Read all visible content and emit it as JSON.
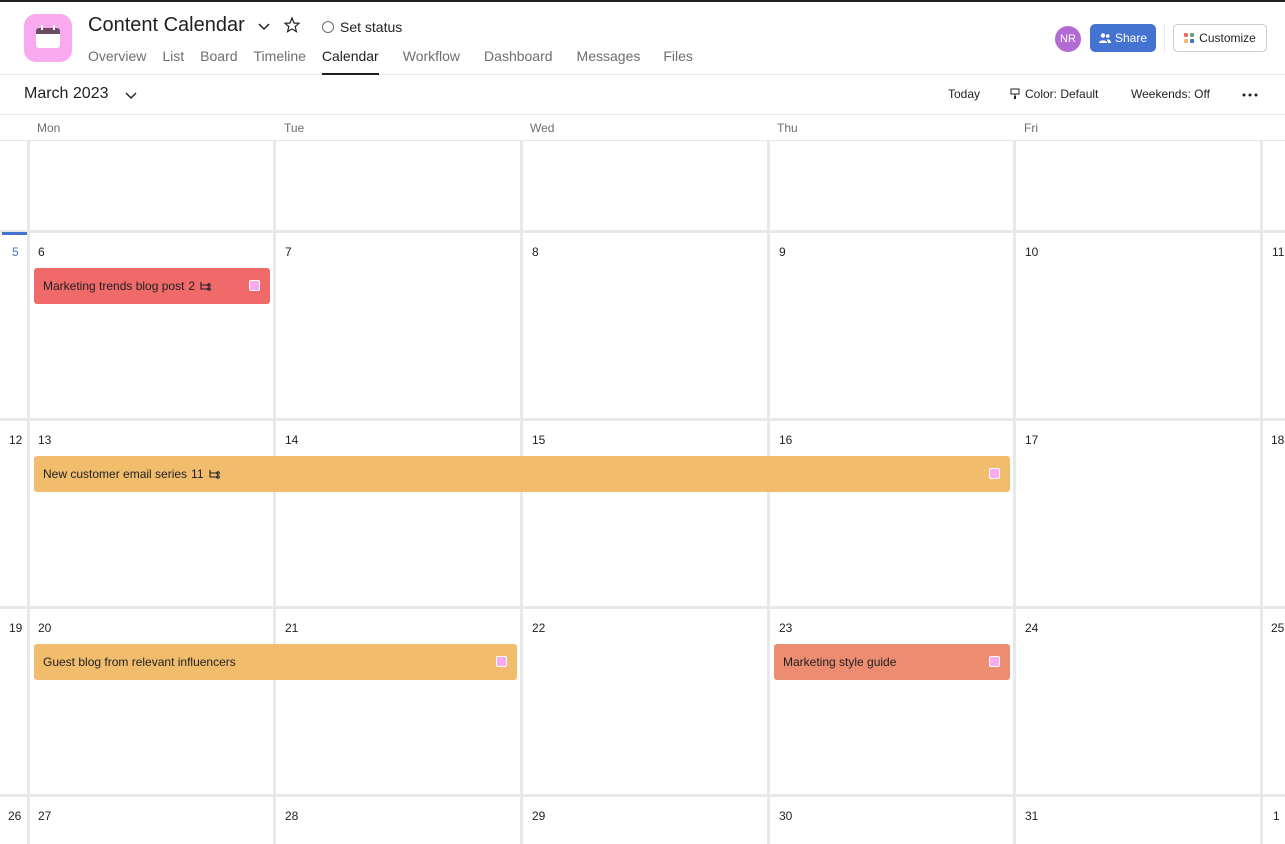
{
  "app": {
    "title": "Content Calendar",
    "set_status_label": "Set status",
    "tabs": [
      {
        "label": "Overview"
      },
      {
        "label": "List"
      },
      {
        "label": "Board"
      },
      {
        "label": "Timeline"
      },
      {
        "label": "Calendar",
        "active": true
      },
      {
        "label": "Workflow"
      },
      {
        "label": "Dashboard"
      },
      {
        "label": "Messages"
      },
      {
        "label": "Files"
      }
    ],
    "avatar_initials": "NR",
    "share_label": "Share",
    "customize_label": "Customize",
    "icon_color": "#f9aaef"
  },
  "toolbar": {
    "month": "March 2023",
    "today_label": "Today",
    "color_label": "Color: Default",
    "weekends_label": "Weekends: Off"
  },
  "calendar": {
    "days_of_week": [
      "Mon",
      "Tue",
      "Wed",
      "Thu",
      "Fri"
    ],
    "weeks": [
      {
        "week_num": "",
        "days": [
          "",
          "",
          "",
          "",
          ""
        ],
        "trailing": ""
      },
      {
        "week_num": "5",
        "days": [
          "6",
          "7",
          "8",
          "9",
          "10"
        ],
        "trailing": "11"
      },
      {
        "week_num": "12",
        "days": [
          "13",
          "14",
          "15",
          "16",
          "17"
        ],
        "trailing": "18"
      },
      {
        "week_num": "19",
        "days": [
          "20",
          "21",
          "22",
          "23",
          "24"
        ],
        "trailing": "25"
      },
      {
        "week_num": "26",
        "days": [
          "27",
          "28",
          "29",
          "30",
          "31"
        ],
        "trailing": "1"
      }
    ],
    "events": [
      {
        "name": "Marketing trends blog post",
        "subtasks": "2",
        "color": "#f06a6a"
      },
      {
        "name": "New customer email series",
        "subtasks": "11",
        "color": "#f1bd6c"
      },
      {
        "name": "Guest blog from relevant influencers",
        "subtasks": "",
        "color": "#f1bd6c"
      },
      {
        "name": "Marketing style guide",
        "subtasks": "",
        "color": "#ec8d71"
      }
    ]
  },
  "colors": {
    "share_button": "#4573d2",
    "avatar": "#b36bd4",
    "today_marker": "#4573d2"
  }
}
